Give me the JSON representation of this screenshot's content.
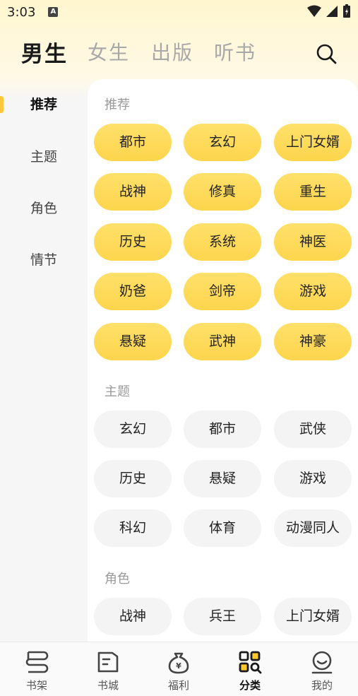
{
  "status_bar": {
    "time": "3:03",
    "notif_icon": "A"
  },
  "top_tabs": [
    {
      "label": "男生",
      "active": true
    },
    {
      "label": "女生",
      "active": false
    },
    {
      "label": "出版",
      "active": false
    },
    {
      "label": "听书",
      "active": false
    }
  ],
  "side_nav": [
    {
      "label": "推荐",
      "active": true
    },
    {
      "label": "主题",
      "active": false
    },
    {
      "label": "角色",
      "active": false
    },
    {
      "label": "情节",
      "active": false
    }
  ],
  "sections": [
    {
      "title": "推荐",
      "style": "yellow",
      "tags": [
        "都市",
        "玄幻",
        "上门女婿",
        "战神",
        "修真",
        "重生",
        "历史",
        "系统",
        "神医",
        "奶爸",
        "剑帝",
        "游戏",
        "悬疑",
        "武神",
        "神豪"
      ]
    },
    {
      "title": "主题",
      "style": "gray",
      "tags": [
        "玄幻",
        "都市",
        "武侠",
        "历史",
        "悬疑",
        "游戏",
        "科幻",
        "体育",
        "动漫同人"
      ]
    },
    {
      "title": "角色",
      "style": "gray",
      "tags": [
        "战神",
        "兵王",
        "上门女婿"
      ]
    }
  ],
  "bottom_nav": [
    {
      "label": "书架",
      "icon": "bookshelf-icon",
      "active": false
    },
    {
      "label": "书城",
      "icon": "book-store-icon",
      "active": false
    },
    {
      "label": "福利",
      "icon": "money-bag-icon",
      "active": false
    },
    {
      "label": "分类",
      "icon": "category-icon",
      "active": true
    },
    {
      "label": "我的",
      "icon": "profile-smile-icon",
      "active": false
    }
  ],
  "colors": {
    "accent": "#ffc83a",
    "chip_yellow": "#fdd54d",
    "chip_gray": "#f4f4f4"
  }
}
